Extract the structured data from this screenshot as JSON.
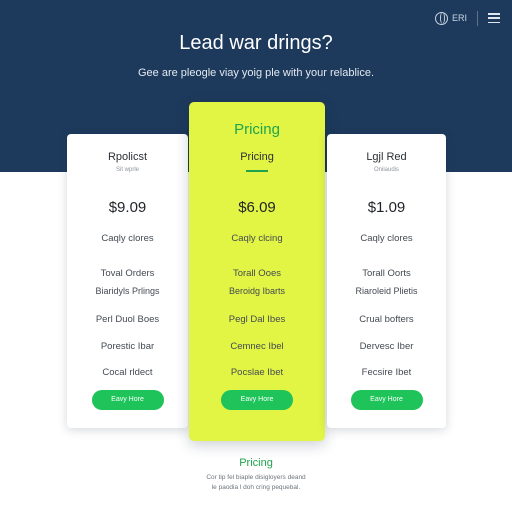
{
  "header": {
    "lang_label": "ERI",
    "title": "Lead war drings?",
    "subtitle": "Gee are pleogle viay yoig ple with your relablice."
  },
  "plans": [
    {
      "name": "Rpolicst",
      "sub": "Sit wprle",
      "price": "$9.09",
      "features": [
        "Caqly clores",
        "Toval Orders",
        "Biaridyls Prlings",
        "Perl Duol Boes",
        "Porestic Ibar",
        "Cocal rldect"
      ],
      "cta": "Eavy Hore"
    },
    {
      "top_label": "Pricing",
      "name": "Pricing",
      "price": "$6.09",
      "features": [
        "Caqly clcing",
        "Torall Ooes",
        "Beroidg Ibarts",
        "Pegl Dal Ibes",
        "Cemnec Ibel",
        "Pocslae Ibet"
      ],
      "cta": "Eavy Hore"
    },
    {
      "name": "Lgjl Red",
      "sub": "Oniiaudis",
      "price": "$1.09",
      "features": [
        "Caqly clores",
        "Torall Oorts",
        "Riaroleid Plietis",
        "Crual bofters",
        "Dervesc Iber",
        "Fecsire Ibet"
      ],
      "cta": "Eavy Hore"
    }
  ],
  "footer": {
    "title": "Pricing",
    "line1": "Cor tip fel biaple disigloyers deand",
    "line2": "le paodia l doh cring pequebal."
  }
}
